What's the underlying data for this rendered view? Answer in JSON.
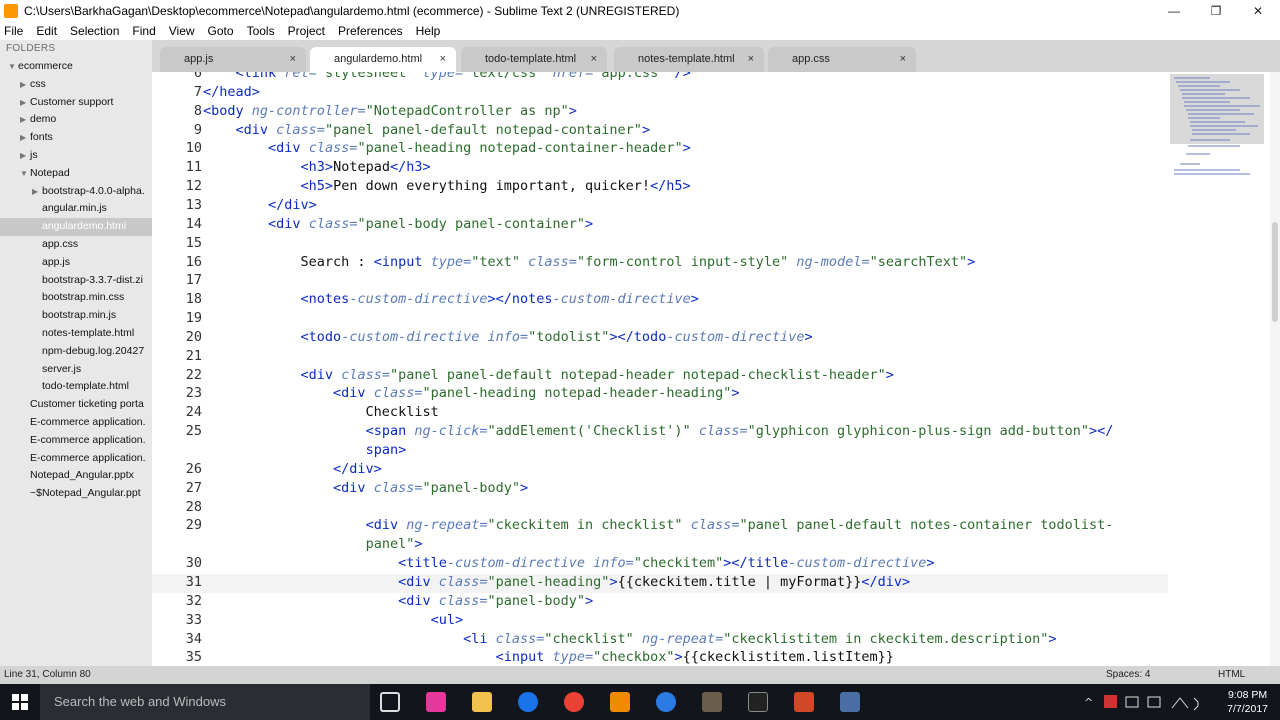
{
  "window": {
    "title": "C:\\Users\\BarkhaGagan\\Desktop\\ecommerce\\Notepad\\angulardemo.html (ecommerce) - Sublime Text 2 (UNREGISTERED)"
  },
  "menu": [
    "File",
    "Edit",
    "Selection",
    "Find",
    "View",
    "Goto",
    "Tools",
    "Project",
    "Preferences",
    "Help"
  ],
  "sidebar": {
    "header": "FOLDERS",
    "items": [
      {
        "label": "ecommerce",
        "arrow": "▼",
        "indent": 0
      },
      {
        "label": "css",
        "arrow": "▶",
        "indent": 1
      },
      {
        "label": "Customer support",
        "arrow": "▶",
        "indent": 1
      },
      {
        "label": "demo",
        "arrow": "▶",
        "indent": 1
      },
      {
        "label": "fonts",
        "arrow": "▶",
        "indent": 1
      },
      {
        "label": "js",
        "arrow": "▶",
        "indent": 1
      },
      {
        "label": "Notepad",
        "arrow": "▼",
        "indent": 1
      },
      {
        "label": "bootstrap-4.0.0-alpha.",
        "arrow": "▶",
        "indent": 2
      },
      {
        "label": "angular.min.js",
        "arrow": "",
        "indent": 2
      },
      {
        "label": "angulardemo.html",
        "arrow": "",
        "indent": 2,
        "selected": true
      },
      {
        "label": "app.css",
        "arrow": "",
        "indent": 2
      },
      {
        "label": "app.js",
        "arrow": "",
        "indent": 2
      },
      {
        "label": "bootstrap-3.3.7-dist.zi",
        "arrow": "",
        "indent": 2
      },
      {
        "label": "bootstrap.min.css",
        "arrow": "",
        "indent": 2
      },
      {
        "label": "bootstrap.min.js",
        "arrow": "",
        "indent": 2
      },
      {
        "label": "notes-template.html",
        "arrow": "",
        "indent": 2
      },
      {
        "label": "npm-debug.log.20427",
        "arrow": "",
        "indent": 2
      },
      {
        "label": "server.js",
        "arrow": "",
        "indent": 2
      },
      {
        "label": "todo-template.html",
        "arrow": "",
        "indent": 2
      },
      {
        "label": "Customer ticketing porta",
        "arrow": "",
        "indent": 1
      },
      {
        "label": "E-commerce application.",
        "arrow": "",
        "indent": 1
      },
      {
        "label": "E-commerce application.",
        "arrow": "",
        "indent": 1
      },
      {
        "label": "E-commerce application.",
        "arrow": "",
        "indent": 1
      },
      {
        "label": "Notepad_Angular.pptx",
        "arrow": "",
        "indent": 1
      },
      {
        "label": "~$Notepad_Angular.ppt",
        "arrow": "",
        "indent": 1
      }
    ]
  },
  "tabs": [
    {
      "label": "app.js",
      "close": "×",
      "active": false
    },
    {
      "label": "angulardemo.html",
      "close": "×",
      "active": true
    },
    {
      "label": "todo-template.html",
      "close": "×",
      "active": false
    },
    {
      "label": "notes-template.html",
      "close": "×",
      "active": false
    },
    {
      "label": "app.css",
      "close": "×",
      "active": false
    }
  ],
  "code": [
    {
      "n": "6",
      "segs": [
        [
          "p",
          "    "
        ],
        [
          "t",
          "<link"
        ],
        [
          "p",
          " "
        ],
        [
          "a",
          "rel="
        ],
        [
          "s",
          "\"stylesheet\""
        ],
        [
          "p",
          " "
        ],
        [
          "a",
          "type="
        ],
        [
          "s",
          "\"text/css\""
        ],
        [
          "p",
          " "
        ],
        [
          "a",
          "href="
        ],
        [
          "s",
          "\"app.css\""
        ],
        [
          "p",
          " "
        ],
        [
          "t",
          "/>"
        ]
      ]
    },
    {
      "n": "7",
      "segs": [
        [
          "t",
          "</head>"
        ]
      ]
    },
    {
      "n": "8",
      "segs": [
        [
          "t",
          "<body"
        ],
        [
          "p",
          " "
        ],
        [
          "a",
          "ng-controller="
        ],
        [
          "s",
          "\"NotepadController as np\""
        ],
        [
          "t",
          ">"
        ]
      ]
    },
    {
      "n": "9",
      "segs": [
        [
          "p",
          "    "
        ],
        [
          "t",
          "<div"
        ],
        [
          "p",
          " "
        ],
        [
          "a",
          "class="
        ],
        [
          "s",
          "\"panel panel-default notepad-container\""
        ],
        [
          "t",
          ">"
        ]
      ]
    },
    {
      "n": "10",
      "segs": [
        [
          "p",
          "        "
        ],
        [
          "t",
          "<div"
        ],
        [
          "p",
          " "
        ],
        [
          "a",
          "class="
        ],
        [
          "s",
          "\"panel-heading notepad-container-header\""
        ],
        [
          "t",
          ">"
        ]
      ]
    },
    {
      "n": "11",
      "segs": [
        [
          "p",
          "            "
        ],
        [
          "t",
          "<h3>"
        ],
        [
          "p",
          "Notepad"
        ],
        [
          "t",
          "</h3>"
        ]
      ]
    },
    {
      "n": "12",
      "segs": [
        [
          "p",
          "            "
        ],
        [
          "t",
          "<h5>"
        ],
        [
          "p",
          "Pen down everything important, quicker!"
        ],
        [
          "t",
          "</h5>"
        ]
      ]
    },
    {
      "n": "13",
      "segs": [
        [
          "p",
          "        "
        ],
        [
          "t",
          "</div>"
        ]
      ]
    },
    {
      "n": "14",
      "segs": [
        [
          "p",
          "        "
        ],
        [
          "t",
          "<div"
        ],
        [
          "p",
          " "
        ],
        [
          "a",
          "class="
        ],
        [
          "s",
          "\"panel-body panel-container\""
        ],
        [
          "t",
          ">"
        ]
      ]
    },
    {
      "n": "15",
      "segs": []
    },
    {
      "n": "16",
      "segs": [
        [
          "p",
          "            Search : "
        ],
        [
          "t",
          "<input"
        ],
        [
          "p",
          " "
        ],
        [
          "a",
          "type="
        ],
        [
          "s",
          "\"text\""
        ],
        [
          "p",
          " "
        ],
        [
          "a",
          "class="
        ],
        [
          "s",
          "\"form-control input-style\""
        ],
        [
          "p",
          " "
        ],
        [
          "a",
          "ng-model="
        ],
        [
          "s",
          "\"searchText\""
        ],
        [
          "t",
          ">"
        ]
      ]
    },
    {
      "n": "17",
      "segs": []
    },
    {
      "n": "18",
      "segs": [
        [
          "p",
          "            "
        ],
        [
          "t",
          "<notes"
        ],
        [
          "a",
          "-custom-directive"
        ],
        [
          "t",
          "></notes"
        ],
        [
          "a",
          "-custom-directive"
        ],
        [
          "t",
          ">"
        ]
      ]
    },
    {
      "n": "19",
      "segs": []
    },
    {
      "n": "20",
      "segs": [
        [
          "p",
          "            "
        ],
        [
          "t",
          "<todo"
        ],
        [
          "a",
          "-custom-directive"
        ],
        [
          "p",
          " "
        ],
        [
          "a",
          "info="
        ],
        [
          "s",
          "\"todolist\""
        ],
        [
          "t",
          "></todo"
        ],
        [
          "a",
          "-custom-directive"
        ],
        [
          "t",
          ">"
        ]
      ]
    },
    {
      "n": "21",
      "segs": []
    },
    {
      "n": "22",
      "segs": [
        [
          "p",
          "            "
        ],
        [
          "t",
          "<div"
        ],
        [
          "p",
          " "
        ],
        [
          "a",
          "class="
        ],
        [
          "s",
          "\"panel panel-default notepad-header notepad-checklist-header\""
        ],
        [
          "t",
          ">"
        ]
      ]
    },
    {
      "n": "23",
      "segs": [
        [
          "p",
          "                "
        ],
        [
          "t",
          "<div"
        ],
        [
          "p",
          " "
        ],
        [
          "a",
          "class="
        ],
        [
          "s",
          "\"panel-heading notepad-header-heading\""
        ],
        [
          "t",
          ">"
        ]
      ]
    },
    {
      "n": "24",
      "segs": [
        [
          "p",
          "                    Checklist"
        ]
      ]
    },
    {
      "n": "25",
      "segs": [
        [
          "p",
          "                    "
        ],
        [
          "t",
          "<span"
        ],
        [
          "p",
          " "
        ],
        [
          "a",
          "ng-click="
        ],
        [
          "s",
          "\"addElement('Checklist')\""
        ],
        [
          "p",
          " "
        ],
        [
          "a",
          "class="
        ],
        [
          "s",
          "\"glyphicon glyphicon-plus-sign add-button\""
        ],
        [
          "t",
          "></"
        ]
      ]
    },
    {
      "n": "",
      "segs": [
        [
          "p",
          "                    "
        ],
        [
          "t",
          "span>"
        ]
      ]
    },
    {
      "n": "26",
      "segs": [
        [
          "p",
          "                "
        ],
        [
          "t",
          "</div>"
        ]
      ]
    },
    {
      "n": "27",
      "segs": [
        [
          "p",
          "                "
        ],
        [
          "t",
          "<div"
        ],
        [
          "p",
          " "
        ],
        [
          "a",
          "class="
        ],
        [
          "s",
          "\"panel-body\""
        ],
        [
          "t",
          ">"
        ]
      ]
    },
    {
      "n": "28",
      "segs": []
    },
    {
      "n": "29",
      "segs": [
        [
          "p",
          "                    "
        ],
        [
          "t",
          "<div"
        ],
        [
          "p",
          " "
        ],
        [
          "a",
          "ng-repeat="
        ],
        [
          "s",
          "\"ckeckitem in checklist\""
        ],
        [
          "p",
          " "
        ],
        [
          "a",
          "class="
        ],
        [
          "s",
          "\"panel panel-default notes-container todolist-"
        ]
      ]
    },
    {
      "n": "",
      "segs": [
        [
          "p",
          "                    "
        ],
        [
          "s",
          "panel\""
        ],
        [
          "t",
          ">"
        ]
      ]
    },
    {
      "n": "30",
      "segs": [
        [
          "p",
          "                        "
        ],
        [
          "t",
          "<title"
        ],
        [
          "a",
          "-custom-directive"
        ],
        [
          "p",
          " "
        ],
        [
          "a",
          "info="
        ],
        [
          "s",
          "\"checkitem\""
        ],
        [
          "t",
          "></title"
        ],
        [
          "a",
          "-custom-directive"
        ],
        [
          "t",
          ">"
        ]
      ]
    },
    {
      "n": "31",
      "segs": [
        [
          "p",
          "                        "
        ],
        [
          "t",
          "<div"
        ],
        [
          "p",
          " "
        ],
        [
          "a",
          "class="
        ],
        [
          "s",
          "\"panel-heading\""
        ],
        [
          "t",
          ">"
        ],
        [
          "p",
          "{{ckeckitem.title | myFormat}}"
        ],
        [
          "t",
          "</div>"
        ]
      ],
      "current": true
    },
    {
      "n": "32",
      "segs": [
        [
          "p",
          "                        "
        ],
        [
          "t",
          "<div"
        ],
        [
          "p",
          " "
        ],
        [
          "a",
          "class="
        ],
        [
          "s",
          "\"panel-body\""
        ],
        [
          "t",
          ">"
        ]
      ]
    },
    {
      "n": "33",
      "segs": [
        [
          "p",
          "                            "
        ],
        [
          "t",
          "<ul>"
        ]
      ]
    },
    {
      "n": "34",
      "segs": [
        [
          "p",
          "                                "
        ],
        [
          "t",
          "<li"
        ],
        [
          "p",
          " "
        ],
        [
          "a",
          "class="
        ],
        [
          "s",
          "\"checklist\""
        ],
        [
          "p",
          " "
        ],
        [
          "a",
          "ng-repeat="
        ],
        [
          "s",
          "\"ckecklistitem in ckeckitem.description\""
        ],
        [
          "t",
          ">"
        ]
      ]
    },
    {
      "n": "35",
      "segs": [
        [
          "p",
          "                                    "
        ],
        [
          "t",
          "<input"
        ],
        [
          "p",
          " "
        ],
        [
          "a",
          "type="
        ],
        [
          "s",
          "\"checkbox\""
        ],
        [
          "t",
          ">"
        ],
        [
          "p",
          "{{ckecklistitem.listItem}}"
        ]
      ]
    }
  ],
  "status": {
    "position": "Line 31, Column 80",
    "spaces": "Spaces: 4",
    "syntax": "HTML"
  },
  "taskbar": {
    "search_placeholder": "Search the web and Windows",
    "time": "9:08 PM",
    "date": "7/7/2017"
  }
}
